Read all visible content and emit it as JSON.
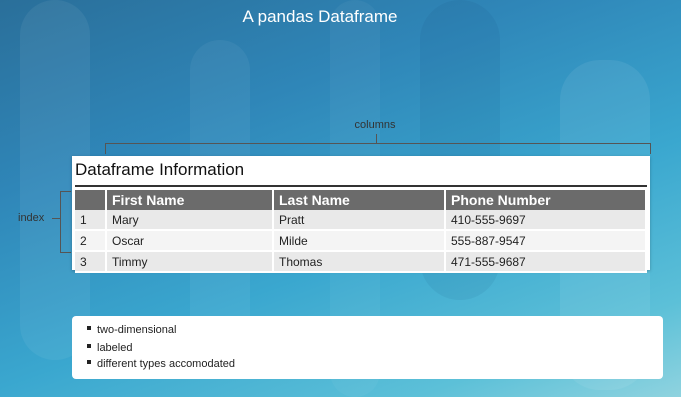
{
  "slide_title": "A pandas Dataframe",
  "annotations": {
    "columns": "columns",
    "index": "index"
  },
  "dataframe": {
    "title": "Dataframe Information",
    "headers": [
      "",
      "First Name",
      "Last Name",
      "Phone Number"
    ],
    "rows": [
      [
        "1",
        "Mary",
        "Pratt",
        "410-555-9697"
      ],
      [
        "2",
        "Oscar",
        "Milde",
        "555-887-9547"
      ],
      [
        "3",
        "Timmy",
        "Thomas",
        "471-555-9687"
      ]
    ]
  },
  "bullets": [
    "two-dimensional",
    "labeled",
    "different types accomodated"
  ]
}
